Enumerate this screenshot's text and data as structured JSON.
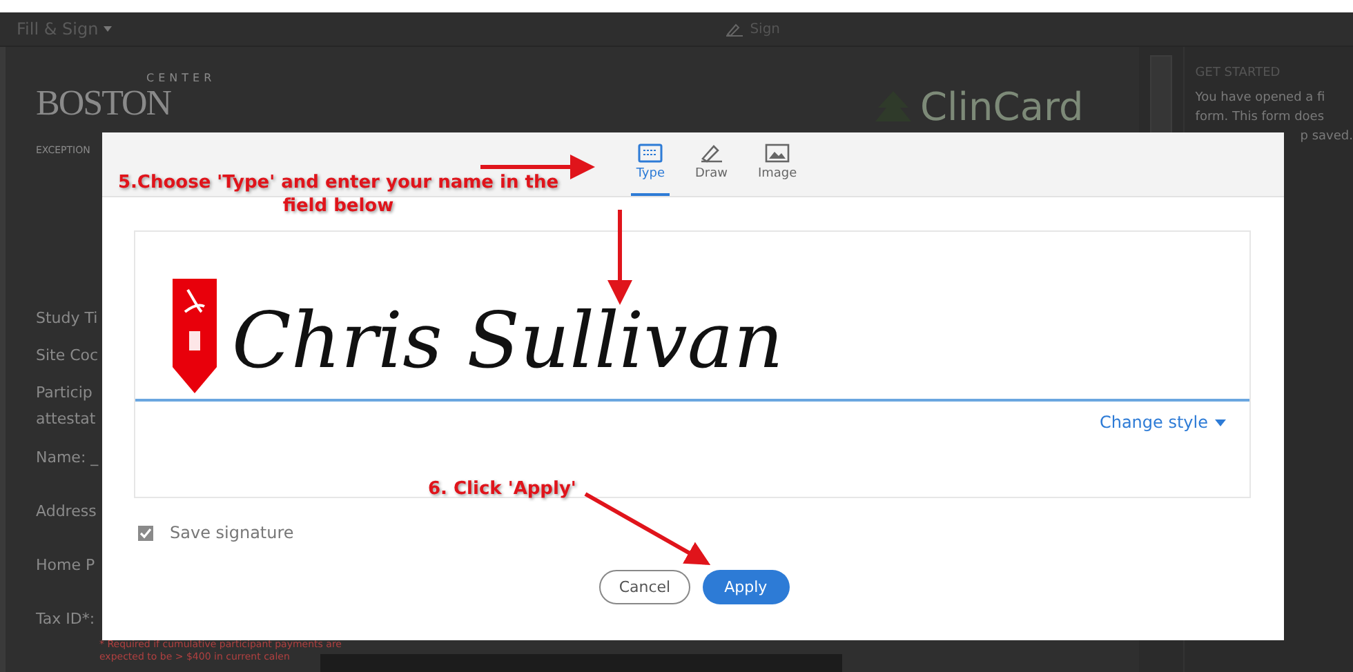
{
  "app": {
    "menu": "Fill & Sign",
    "sign_tool": "Sign"
  },
  "document": {
    "logo": {
      "top": "CENTER",
      "name": "BOSTON",
      "tagline": "EXCEPTION"
    },
    "brand": "ClinCard",
    "fields": [
      "Study Ti",
      "Site Coc",
      "Particip",
      "attestat",
      "Name: _",
      "Address",
      "Home P",
      "Tax ID*:"
    ],
    "note": [
      "* Required if cumulative participant payments are",
      "expected to be > $400 in current calen"
    ]
  },
  "side_panel": {
    "title": "GET STARTED",
    "lines": [
      "You have opened a fi",
      "form. This form does",
      "p saved."
    ]
  },
  "dialog": {
    "tabs": [
      {
        "label": "Type",
        "kind": "type",
        "selected": true
      },
      {
        "label": "Draw",
        "kind": "draw",
        "selected": false
      },
      {
        "label": "Image",
        "kind": "image",
        "selected": false
      }
    ],
    "signature": "Chris Sullivan",
    "change_style": "Change style",
    "save_signature": {
      "label": "Save signature",
      "checked": true
    },
    "buttons": [
      {
        "label": "Cancel",
        "kind": "secondary"
      },
      {
        "label": "Apply",
        "kind": "primary"
      }
    ]
  },
  "annotations": [
    {
      "text": "5.Choose 'Type' and enter your name in the field below",
      "kind": "step5"
    },
    {
      "text": "6. Click 'Apply'",
      "kind": "step6"
    }
  ]
}
